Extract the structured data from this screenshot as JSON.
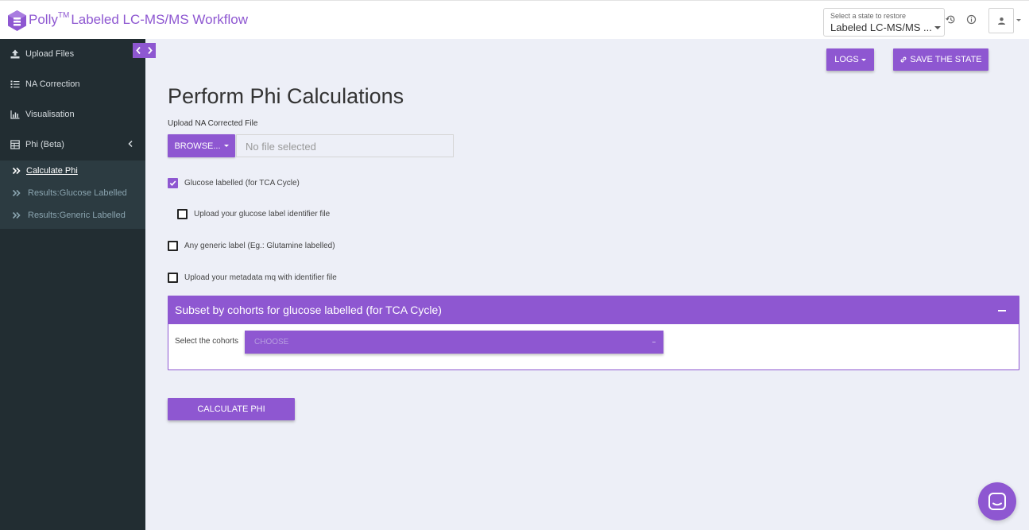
{
  "header": {
    "brand": "Polly",
    "trademark": "TM",
    "title": "Labeled LC-MS/MS Workflow",
    "state_select": {
      "label": "Select a state to restore",
      "value": "Labeled LC-MS/MS ..."
    }
  },
  "sidebar": {
    "items": [
      {
        "label": "Upload Files",
        "icon": "upload-icon"
      },
      {
        "label": "NA Correction",
        "icon": "list-icon"
      },
      {
        "label": "Visualisation",
        "icon": "bar-chart-icon"
      },
      {
        "label": "Phi (Beta)",
        "icon": "table-icon"
      }
    ],
    "submenu": [
      {
        "label": "Calculate Phi",
        "active": true
      },
      {
        "label": "Results:Glucose Labelled",
        "active": false
      },
      {
        "label": "Results:Generic Labelled",
        "active": false
      }
    ]
  },
  "toolbar": {
    "logs_label": "LOGS",
    "save_state_label": "SAVE THE STATE"
  },
  "main": {
    "title": "Perform Phi Calculations",
    "upload_label": "Upload NA Corrected File",
    "browse_label": "BROWSE...",
    "file_placeholder": "No file selected",
    "checkboxes": [
      {
        "label": "Glucose labelled (for TCA Cycle)",
        "checked": true
      },
      {
        "label": "Upload your glucose label identifier file",
        "checked": false
      },
      {
        "label": "Any generic label (Eg.: Glutamine labelled)",
        "checked": false
      },
      {
        "label": "Upload your metadata mq with identifier file",
        "checked": false
      }
    ],
    "panel": {
      "title": "Subset by cohorts for glucose labelled (for TCA Cycle)",
      "cohort_label": "Select the cohorts",
      "cohort_placeholder": "CHOOSE"
    },
    "calculate_label": "CALCULATE PHI"
  },
  "colors": {
    "accent": "#8e57d1",
    "sidebar_bg": "#222d32",
    "content_bg": "#edeff7"
  }
}
